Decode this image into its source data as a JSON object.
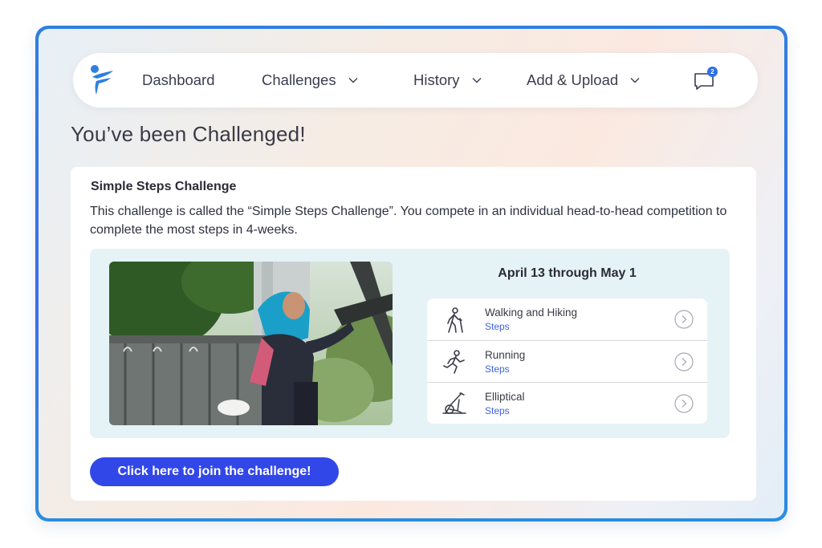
{
  "nav": {
    "items": [
      {
        "label": "Dashboard"
      },
      {
        "label": "Challenges"
      },
      {
        "label": "History"
      },
      {
        "label": "Add & Upload"
      }
    ],
    "notifications_count": "2"
  },
  "page": {
    "title": "You’ve been Challenged!"
  },
  "challenge": {
    "name": "Simple Steps Challenge",
    "description": "This challenge is called the “Simple Steps Challenge”. You compete in an individual head-to-head competition to complete the most steps in 4-weeks.",
    "dates": "April 13 through May 1",
    "activities": [
      {
        "name": "Walking and Hiking",
        "unit": "Steps",
        "icon": "walking-icon"
      },
      {
        "name": "Running",
        "unit": "Steps",
        "icon": "running-icon"
      },
      {
        "name": "Elliptical",
        "unit": "Steps",
        "icon": "elliptical-icon"
      }
    ],
    "join_label": "Click here to join the challenge!"
  },
  "colors": {
    "accent": "#3247e8",
    "frame": "#2f7fe0",
    "link": "#3f63d9",
    "panel": "#e5f3f7"
  }
}
